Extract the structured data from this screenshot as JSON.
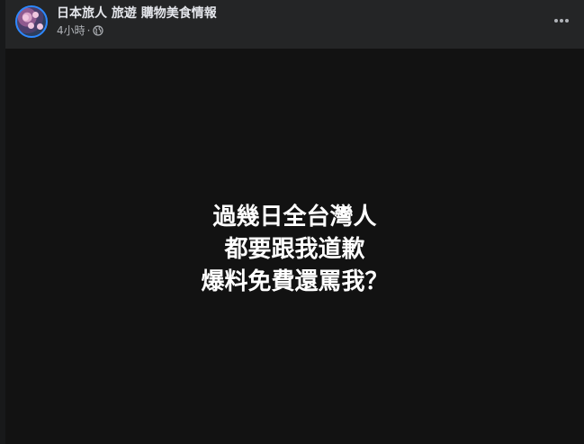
{
  "post": {
    "page_name": "日本旅人 旅遊 購物美食情報",
    "timestamp": "4小時",
    "separator": "·",
    "privacy_icon": "globe-icon",
    "more_icon": "more-options-icon",
    "avatar_accent": "#2d88ff"
  },
  "media": {
    "lines": [
      "過幾日全台灣人",
      "都要跟我道歉",
      "爆料免費還罵我？"
    ],
    "background": "#121212",
    "text_color": "#ffffff"
  }
}
